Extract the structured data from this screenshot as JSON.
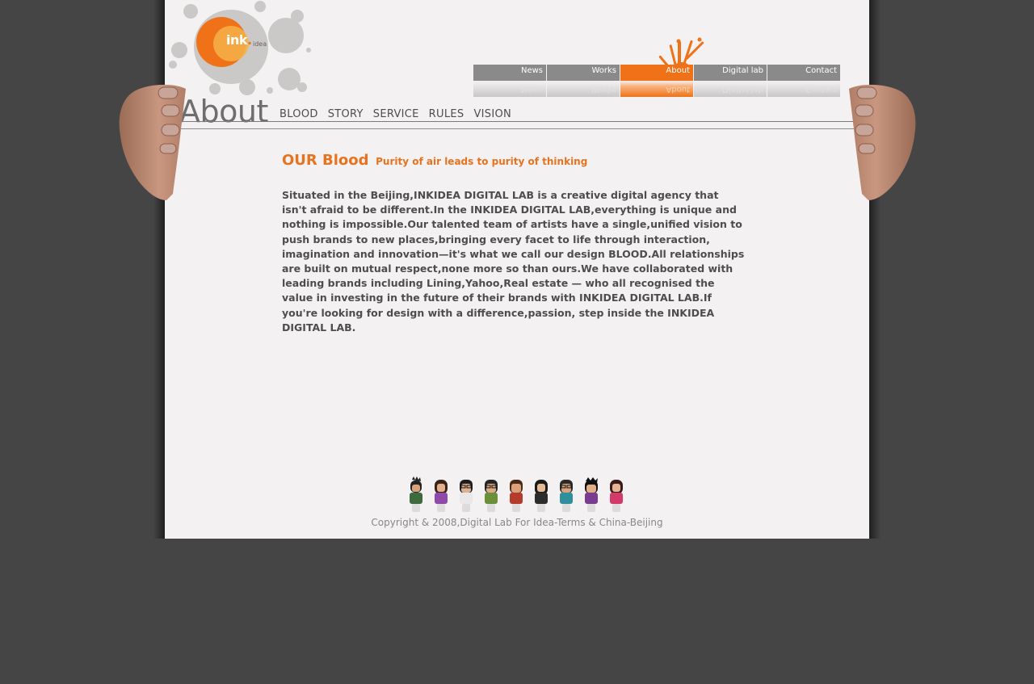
{
  "logo": {
    "brand": "ink",
    "dot": ".",
    "sub": "idea"
  },
  "nav": [
    {
      "label": "News",
      "active": false
    },
    {
      "label": "Works",
      "active": false
    },
    {
      "label": "About",
      "active": true
    },
    {
      "label": "Digital lab",
      "active": false
    },
    {
      "label": "Contact",
      "active": false
    }
  ],
  "section": {
    "title": "About",
    "subnav": [
      "BLOOD",
      "STORY",
      "SERVICE",
      "RULES",
      "VISION"
    ]
  },
  "content": {
    "heading": "OUR Blood",
    "tagline": "Purity of air leads to purity of thinking",
    "body": "Situated in the Beijing,INKIDEA DIGITAL LAB is a creative digital agency that isn't afraid to be different.In the INKIDEA DIGITAL LAB,everything is unique and nothing is impossible.Our talented team of artists have a single,unified vision to push brands to new places,bringing every facet to life through interaction, imagination and innovation—it's what we call our design BLOOD.All relationships are built on mutual respect,none more so than ours.We have collaborated with leading brands including Lining,Yahoo,Real estate — who all recognised the value in investing in the future of their brands with INKIDEA DIGITAL LAB.If you're looking for design with a difference,passion, step inside the INKIDEA DIGITAL LAB."
  },
  "footer": {
    "copyright": "Copyright & 2008,Digital Lab For Idea-Terms & China-Beijing"
  },
  "colors": {
    "accent": "#ef7218",
    "page_bg": "#f3f1f2",
    "outer_bg": "#454545",
    "nav_gray": "#8a8a8a"
  }
}
